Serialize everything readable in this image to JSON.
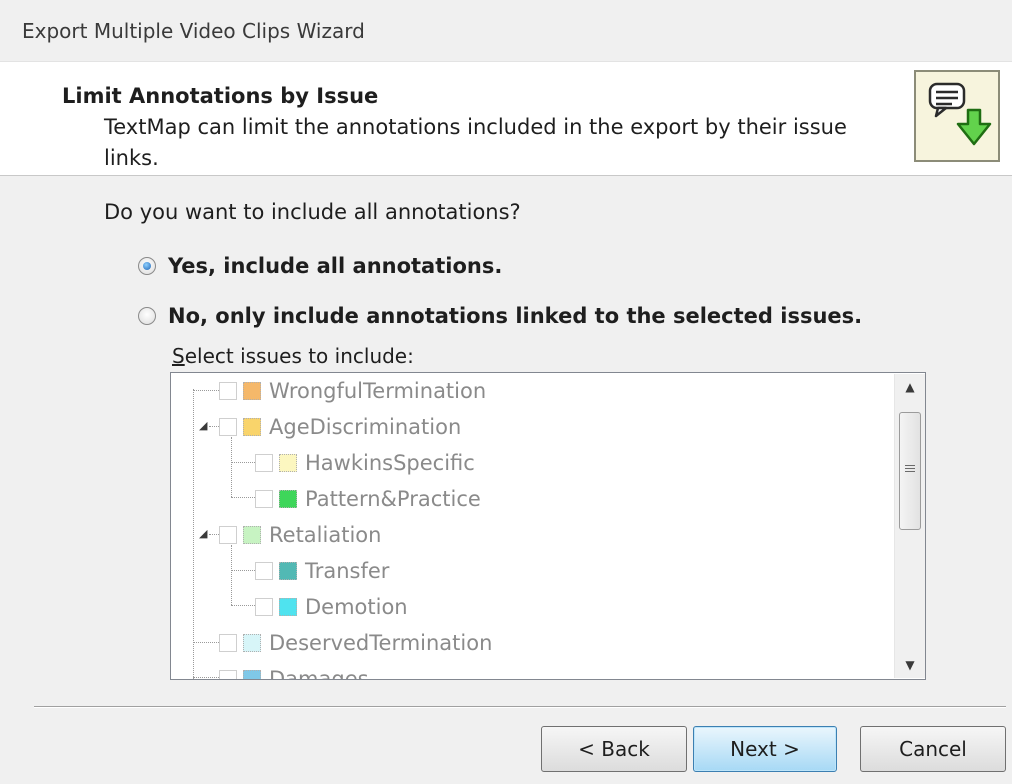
{
  "window": {
    "title": "Export Multiple Video Clips Wizard"
  },
  "header": {
    "title": "Limit Annotations by Issue",
    "description": "TextMap can limit the annotations included in the export by their issue links.",
    "icon": "comment-export-icon"
  },
  "main": {
    "question": "Do you want to include all annotations?",
    "option_all": {
      "label": "Yes, include all annotations.",
      "checked": true
    },
    "option_selected": {
      "label": "No, only include annotations linked to the selected issues.",
      "checked": false
    },
    "select_label_first": "S",
    "select_label_rest": "elect issues to include:"
  },
  "issues": [
    {
      "label": "WrongfulTermination",
      "color": "#f5b86a",
      "level": 0
    },
    {
      "label": "AgeDiscrimination",
      "color": "#f9d46b",
      "level": 0
    },
    {
      "label": "HawkinsSpecific",
      "color": "#fcf7c0",
      "level": 1
    },
    {
      "label": "Pattern&Practice",
      "color": "#3ed65a",
      "level": 1
    },
    {
      "label": "Retaliation",
      "color": "#c7f3c2",
      "level": 0
    },
    {
      "label": "Transfer",
      "color": "#52b9b4",
      "level": 1
    },
    {
      "label": "Demotion",
      "color": "#4fe3ef",
      "level": 1
    },
    {
      "label": "DeservedTermination",
      "color": "#d7f5f8",
      "level": 0
    },
    {
      "label": "Damages",
      "color": "#7fc8e8",
      "level": 0
    }
  ],
  "buttons": {
    "back": "< Back",
    "next": "Next >",
    "cancel": "Cancel"
  },
  "colors": {
    "dialog_bg": "#f0f0f0",
    "default_button": "#a7d9f5",
    "disabled_text": "#8a8a8a"
  }
}
